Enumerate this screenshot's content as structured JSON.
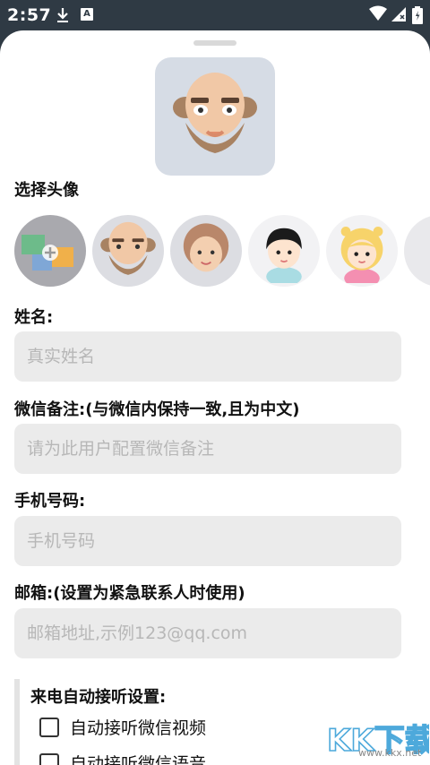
{
  "status_bar": {
    "time": "2:57",
    "icons": [
      "download-icon",
      "a-badge-icon",
      "wifi-icon",
      "signal-icon",
      "battery-icon"
    ]
  },
  "form": {
    "avatar_section_label": "选择头像",
    "avatar_options": [
      "custom-photo",
      "bald-man-beard",
      "curly-hair-woman",
      "boy-black-hair",
      "girl-blonde-pink"
    ],
    "name_label": "姓名:",
    "name_placeholder": "真实姓名",
    "wechat_label": "微信备注:(与微信内保持一致,且为中文)",
    "wechat_placeholder": "请为此用户配置微信备注",
    "phone_label": "手机号码:",
    "phone_placeholder": "手机号码",
    "email_label": "邮箱:(设置为紧急联系人时使用)",
    "email_placeholder": "邮箱地址,示例123@qq.com",
    "auto_answer_title": "来电自动接听设置:",
    "auto_answer_video": "自动接听微信视频",
    "auto_answer_voice": "自动接听微信语音"
  },
  "watermark": {
    "text": "KK下载",
    "url": "www.kkx.net"
  },
  "colors": {
    "status_bar": "#2f3a44",
    "input_bg": "#ebebeb",
    "avatar_bg": "#d6dce5",
    "placeholder": "#b7b7b7"
  }
}
